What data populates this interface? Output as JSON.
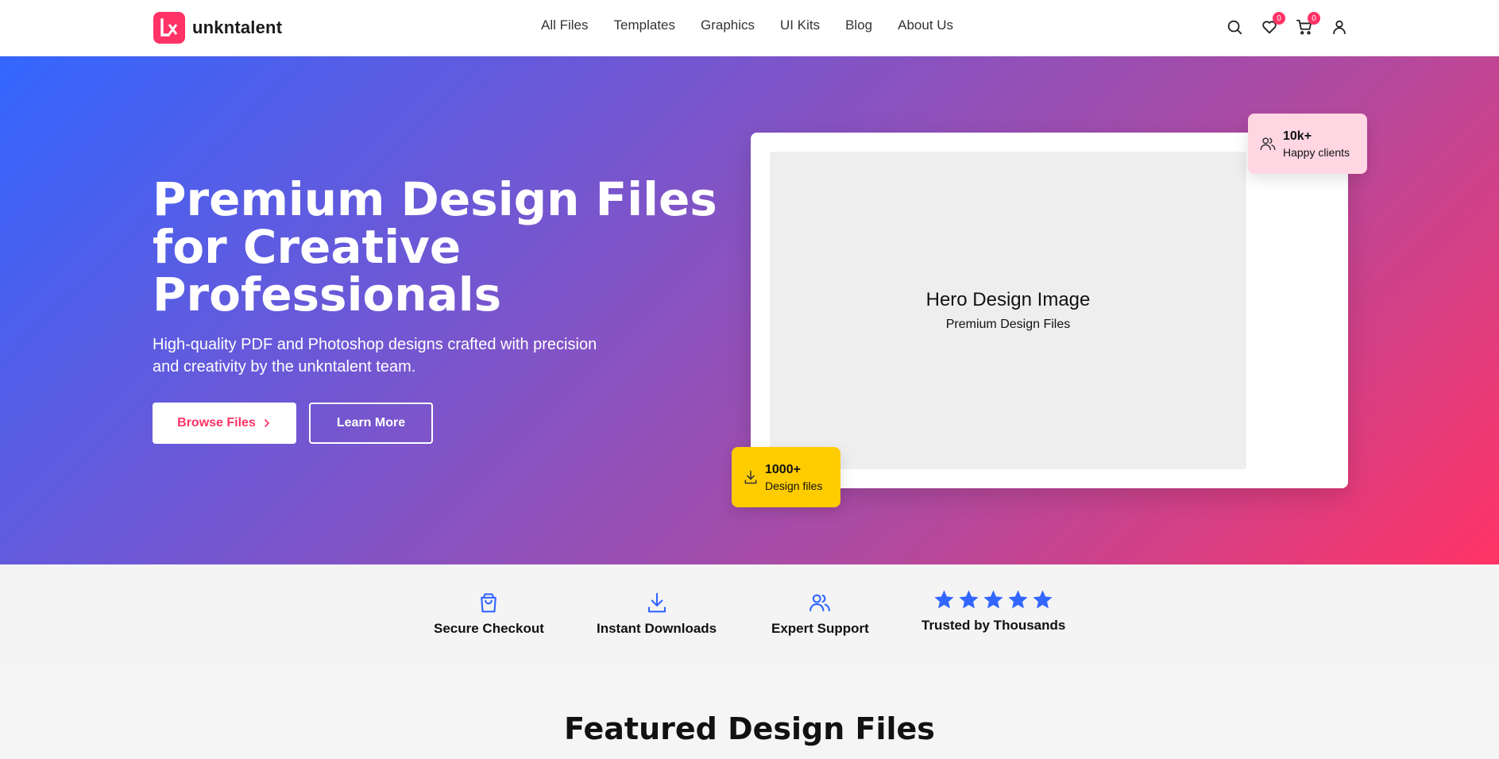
{
  "brand": {
    "name": "unkntalent",
    "accent": "#ff3366",
    "blue": "#3366ff"
  },
  "nav": {
    "items": [
      {
        "label": "All Files"
      },
      {
        "label": "Templates"
      },
      {
        "label": "Graphics"
      },
      {
        "label": "UI Kits"
      },
      {
        "label": "Blog"
      },
      {
        "label": "About Us"
      }
    ]
  },
  "header_icons": {
    "search": "search-icon",
    "wishlist": "heart-icon",
    "wishlist_count": "0",
    "cart": "cart-icon",
    "cart_count": "0",
    "account": "user-icon"
  },
  "hero": {
    "title": "Premium Design Files for Creative Professionals",
    "subtitle": "High-quality PDF and Photoshop designs crafted with precision and creativity by the unkntalent team.",
    "browse_label": "Browse Files",
    "learn_label": "Learn More",
    "image_title": "Hero Design Image",
    "image_subtitle": "Premium Design Files",
    "stat_clients": {
      "value": "10k+",
      "label": "Happy clients",
      "icon": "users-icon"
    },
    "stat_files": {
      "value": "1000+",
      "label": "Design files",
      "icon": "download-icon"
    }
  },
  "features": [
    {
      "label": "Secure Checkout",
      "icon": "shopping-bag-icon"
    },
    {
      "label": "Instant Downloads",
      "icon": "download-icon"
    },
    {
      "label": "Expert Support",
      "icon": "users-icon"
    },
    {
      "label": "Trusted by Thousands",
      "icon": "star-icon",
      "rating": 5
    }
  ],
  "featured": {
    "title": "Featured Design Files"
  }
}
